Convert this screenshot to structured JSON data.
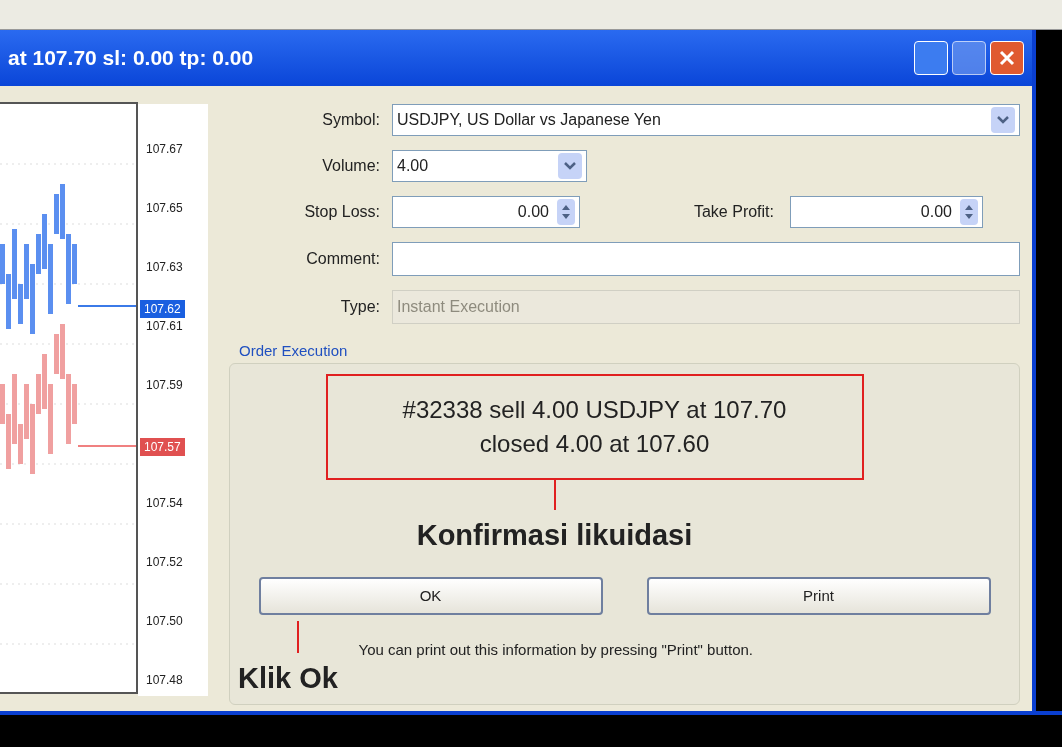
{
  "window": {
    "title": "at 107.70 sl: 0.00 tp: 0.00"
  },
  "price_axis": {
    "ticks": [
      "107.67",
      "107.65",
      "107.63",
      "107.61",
      "107.59",
      "107.54",
      "107.52",
      "107.50",
      "107.48"
    ],
    "tags": [
      {
        "label": "107.62",
        "color": "#1a5fe0"
      },
      {
        "label": "107.57",
        "color": "#e05050"
      }
    ]
  },
  "form": {
    "symbol": {
      "label": "Symbol:",
      "value": "USDJPY, US Dollar vs Japanese Yen"
    },
    "volume": {
      "label": "Volume:",
      "value": "4.00"
    },
    "stop_loss": {
      "label": "Stop Loss:",
      "value": "0.00"
    },
    "take_profit": {
      "label": "Take Profit:",
      "value": "0.00"
    },
    "comment": {
      "label": "Comment:"
    },
    "type": {
      "label": "Type:",
      "value": "Instant Execution",
      "disabled": true
    }
  },
  "order_execution": {
    "title": "Order Execution",
    "message": [
      "#32338 sell 4.00 USDJPY at 107.70",
      "closed 4.00 at 107.60"
    ],
    "buttons": [
      "OK",
      "Print"
    ],
    "hint": "You can print out this information by pressing \"Print\" button."
  },
  "annotations": {
    "confirmation": "Konfirmasi likuidasi",
    "click": "Klik Ok"
  }
}
